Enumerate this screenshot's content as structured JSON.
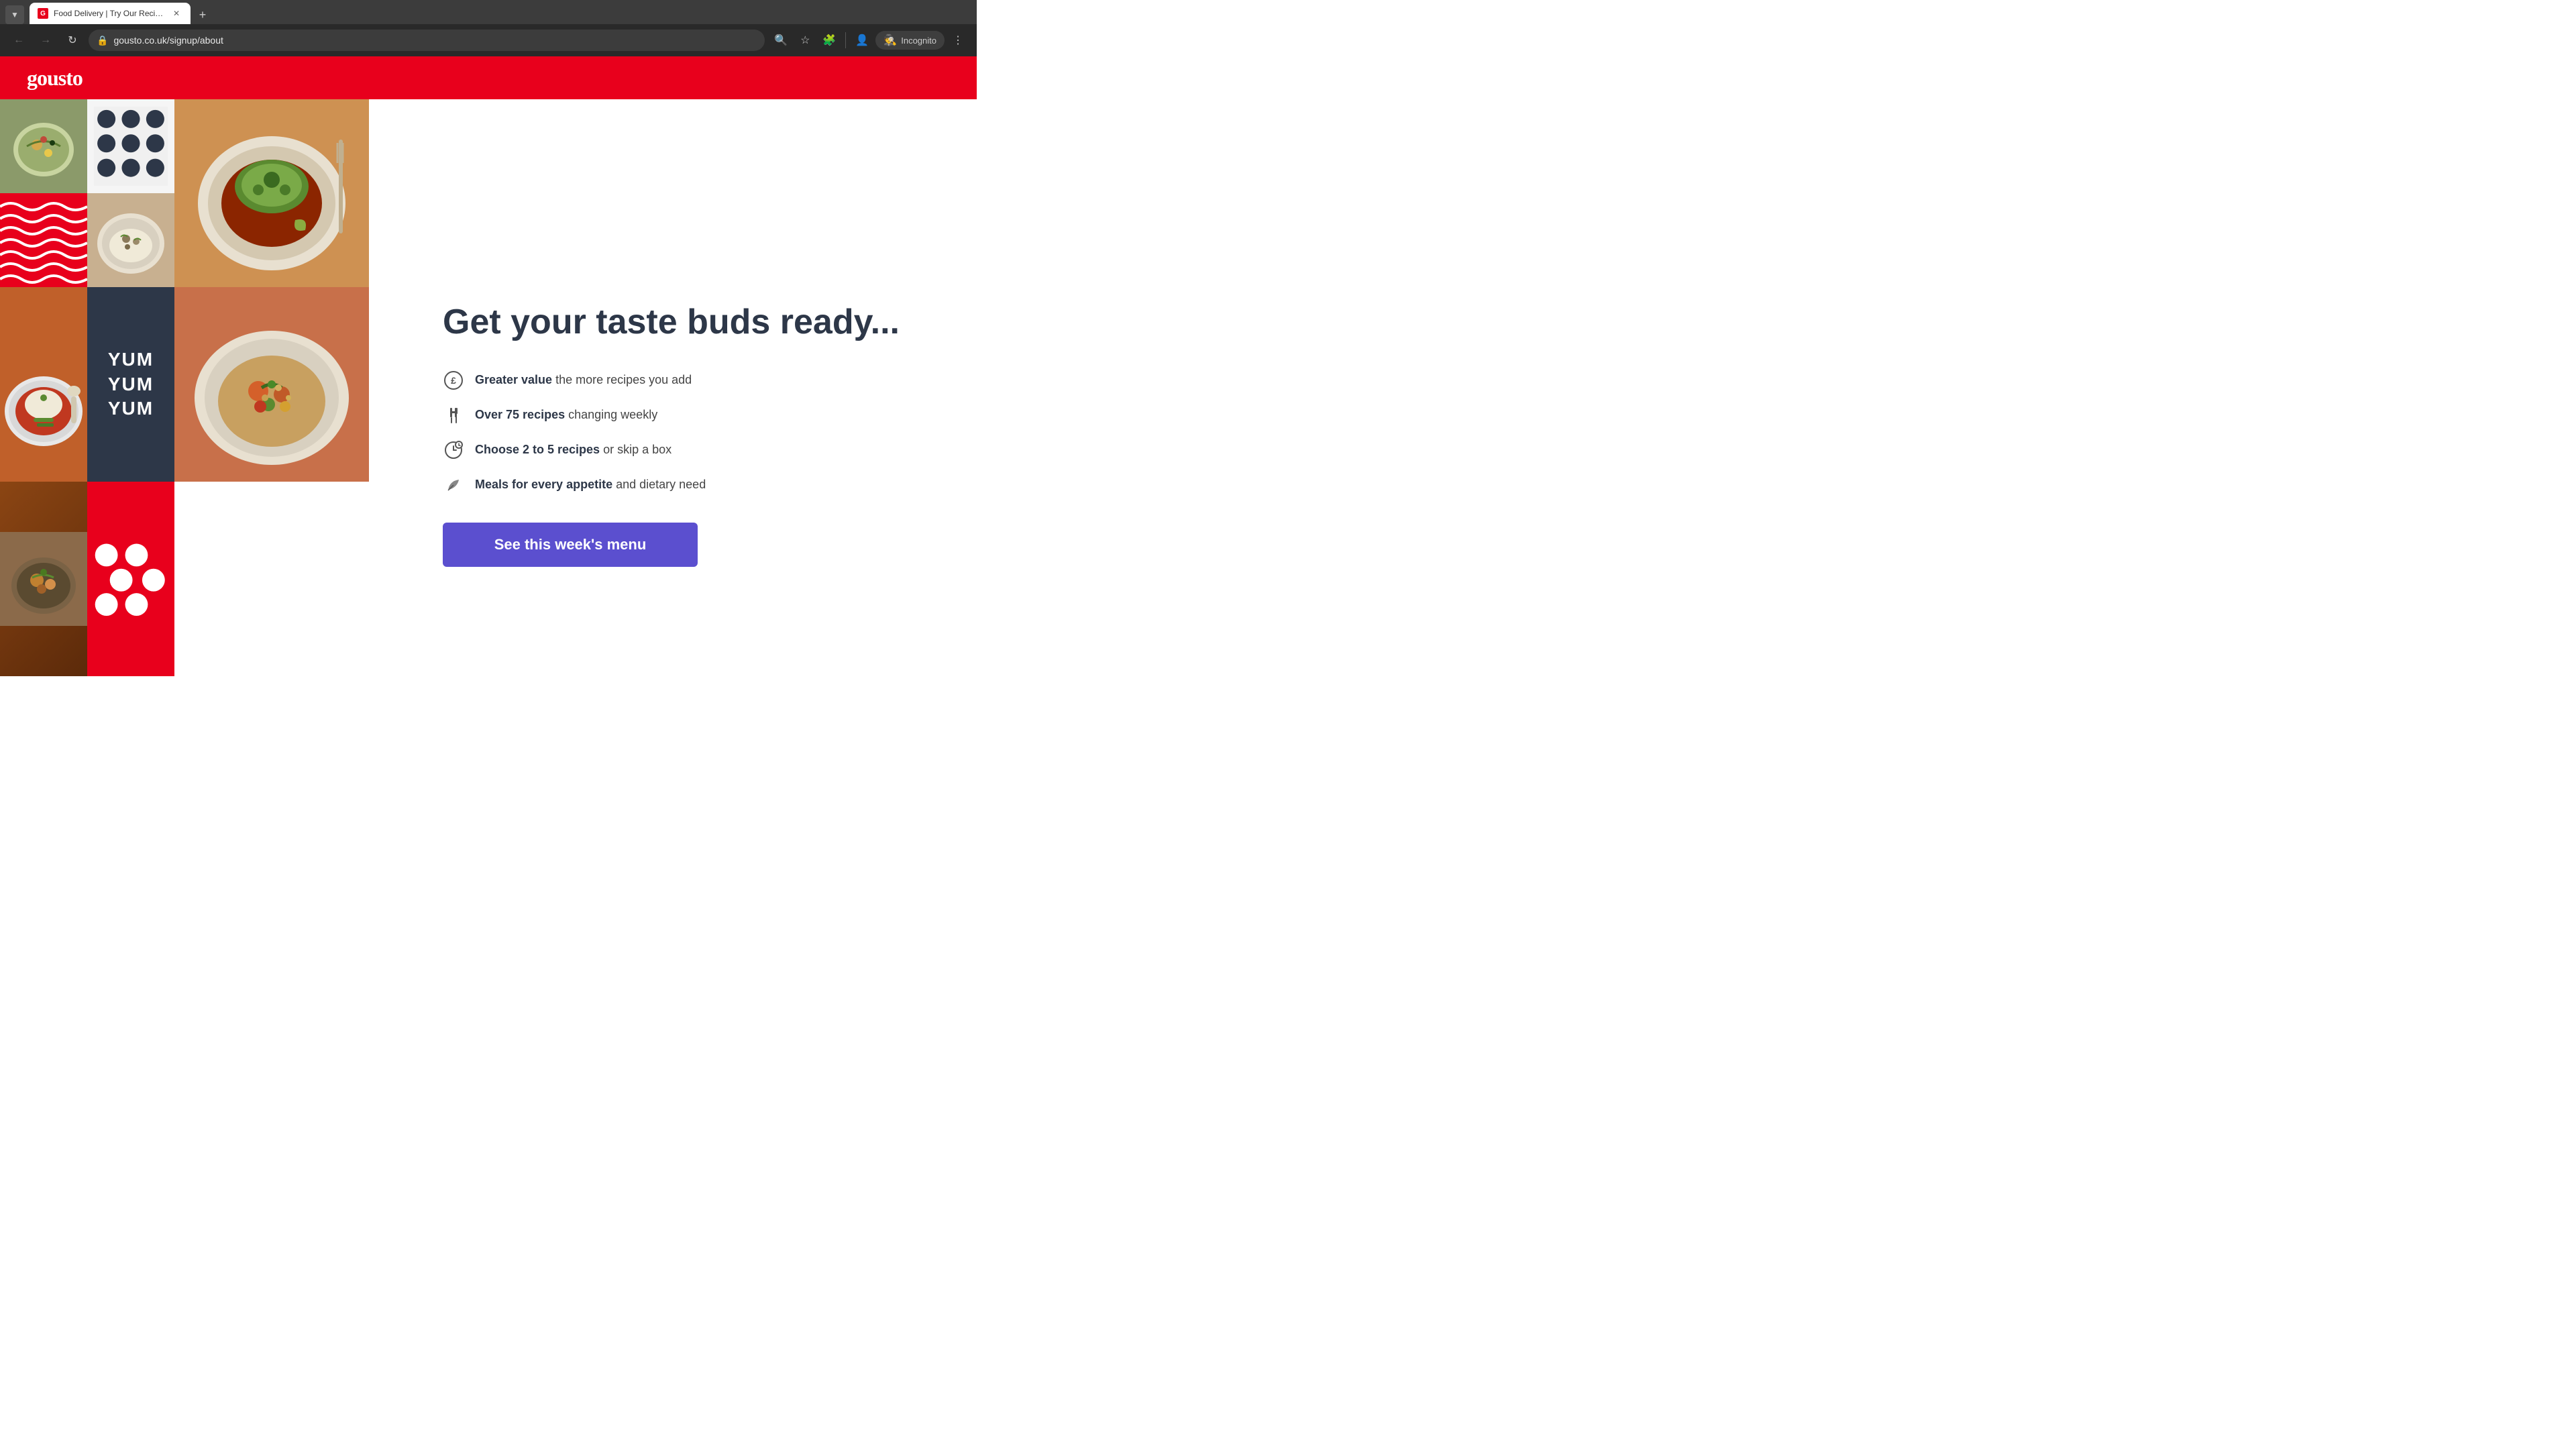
{
  "browser": {
    "tab_title": "Food Delivery | Try Our Recipe ...",
    "tab_favicon": "G",
    "url": "gousto.co.uk/signup/about",
    "new_tab_label": "+",
    "nav": {
      "back": "←",
      "forward": "→",
      "refresh": "↻"
    },
    "incognito_label": "Incognito",
    "menu_label": "⋮"
  },
  "header": {
    "logo": "gousto"
  },
  "hero": {
    "title": "Get your taste buds ready...",
    "features": [
      {
        "icon": "£",
        "text_bold": "Greater value",
        "text_normal": " the more recipes you add"
      },
      {
        "icon": "🍴",
        "text_bold": "Over 75 recipes",
        "text_normal": " changing weekly"
      },
      {
        "icon": "⏱",
        "text_bold": "Choose 2 to 5 recipes",
        "text_normal": " or skip a box"
      },
      {
        "icon": "🌿",
        "text_bold": "Meals for every appetite",
        "text_normal": " and dietary need"
      }
    ],
    "cta_button": "See this week's menu"
  },
  "decorative": {
    "yum_text": "YUM\nYUM\nYUM"
  },
  "colors": {
    "gousto_red": "#e8001c",
    "dark_navy": "#2d3748",
    "purple_cta": "#5b4fcf"
  }
}
